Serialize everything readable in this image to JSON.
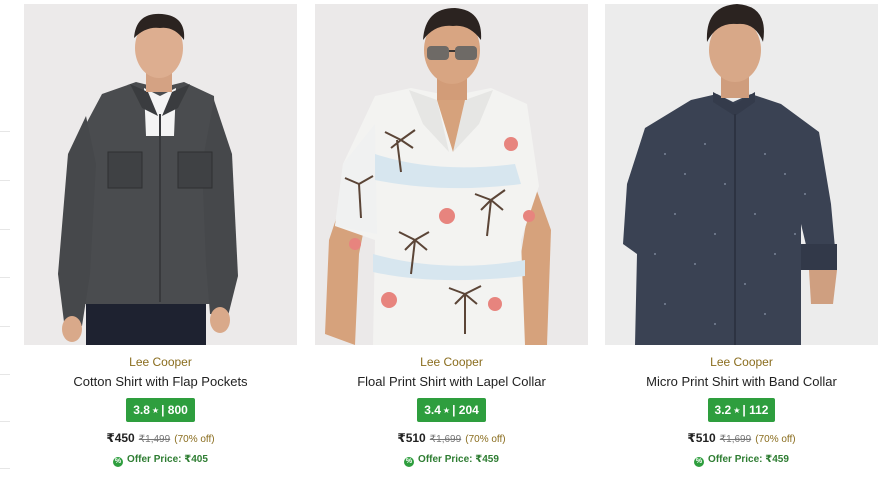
{
  "products": [
    {
      "brand": "Lee Cooper",
      "title": "Cotton Shirt with Flap Pockets",
      "rating": "3.8",
      "rating_count": "800",
      "price": "₹450",
      "mrp": "₹1,499",
      "discount": "(70% off)",
      "offer_label": "Offer Price: ₹405",
      "image": "man-in-dark-grey-denim-shirt"
    },
    {
      "brand": "Lee Cooper",
      "title": "Floal Print Shirt with Lapel Collar",
      "rating": "3.4",
      "rating_count": "204",
      "price": "₹510",
      "mrp": "₹1,699",
      "discount": "(70% off)",
      "offer_label": "Offer Price: ₹459",
      "image": "man-in-white-palm-print-shirt-with-sunglasses"
    },
    {
      "brand": "Lee Cooper",
      "title": "Micro Print Shirt with Band Collar",
      "rating": "3.2",
      "rating_count": "112",
      "price": "₹510",
      "mrp": "₹1,699",
      "discount": "(70% off)",
      "offer_label": "Offer Price: ₹459",
      "image": "man-in-navy-micro-print-shirt"
    }
  ],
  "colors": {
    "rating_badge": "#2e9e3e",
    "brand_text": "#8a6d1e",
    "offer_text": "#2e7d32"
  },
  "icons": {
    "rating": "star-icon",
    "offer": "offer-tag-icon"
  }
}
